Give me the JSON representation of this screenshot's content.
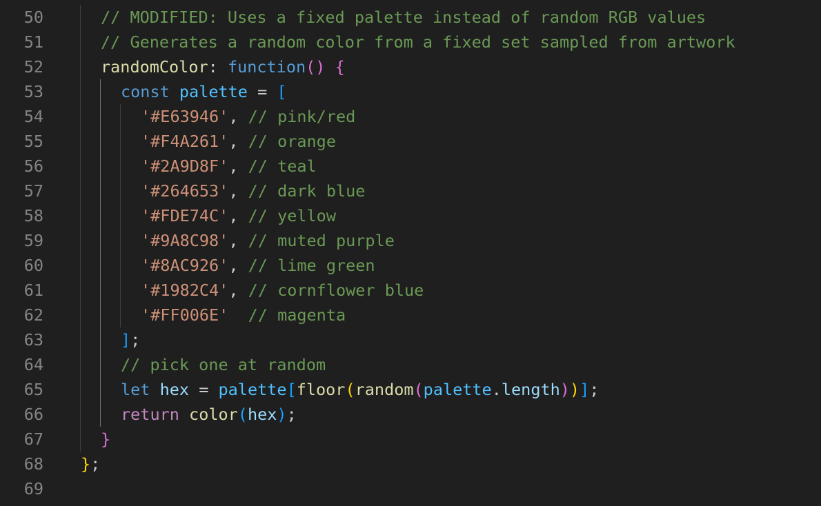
{
  "editor": {
    "language": "javascript",
    "theme_colors": {
      "background": "#1f1f1f",
      "line_number": "#858585",
      "comment": "#6a9955",
      "function": "#dcdcaa",
      "keyword": "#569cd6",
      "control_keyword": "#c586c0",
      "variable": "#9cdcfe",
      "constant": "#4fc1ff",
      "string": "#ce9178",
      "bracket_level_1": "#ffd700",
      "bracket_level_2": "#da70d6",
      "bracket_level_3": "#179fff"
    },
    "lines": [
      {
        "number": "50",
        "indent": 1,
        "tokens": [
          {
            "text": "// MODIFIED: Uses a fixed palette instead of random RGB values",
            "type": "comment"
          }
        ]
      },
      {
        "number": "51",
        "indent": 1,
        "tokens": [
          {
            "text": "// Generates a random color from a fixed set sampled from artwork",
            "type": "comment"
          }
        ]
      },
      {
        "number": "52",
        "indent": 1,
        "tokens": [
          {
            "text": "randomColor",
            "type": "prop"
          },
          {
            "text": ": ",
            "type": "punc"
          },
          {
            "text": "function",
            "type": "kw"
          },
          {
            "text": "()",
            "type": "b2"
          },
          {
            "text": " ",
            "type": "punc"
          },
          {
            "text": "{",
            "type": "b2"
          }
        ]
      },
      {
        "number": "53",
        "indent": 2,
        "tokens": [
          {
            "text": "const",
            "type": "kw"
          },
          {
            "text": " ",
            "type": "punc"
          },
          {
            "text": "palette",
            "type": "const"
          },
          {
            "text": " = ",
            "type": "punc"
          },
          {
            "text": "[",
            "type": "b3"
          }
        ]
      },
      {
        "number": "54",
        "indent": 3,
        "tokens": [
          {
            "text": "'#E63946'",
            "type": "str"
          },
          {
            "text": ", ",
            "type": "punc"
          },
          {
            "text": "// pink/red",
            "type": "comment"
          }
        ]
      },
      {
        "number": "55",
        "indent": 3,
        "tokens": [
          {
            "text": "'#F4A261'",
            "type": "str"
          },
          {
            "text": ", ",
            "type": "punc"
          },
          {
            "text": "// orange",
            "type": "comment"
          }
        ]
      },
      {
        "number": "56",
        "indent": 3,
        "tokens": [
          {
            "text": "'#2A9D8F'",
            "type": "str"
          },
          {
            "text": ", ",
            "type": "punc"
          },
          {
            "text": "// teal",
            "type": "comment"
          }
        ]
      },
      {
        "number": "57",
        "indent": 3,
        "tokens": [
          {
            "text": "'#264653'",
            "type": "str"
          },
          {
            "text": ", ",
            "type": "punc"
          },
          {
            "text": "// dark blue",
            "type": "comment"
          }
        ]
      },
      {
        "number": "58",
        "indent": 3,
        "tokens": [
          {
            "text": "'#FDE74C'",
            "type": "str"
          },
          {
            "text": ", ",
            "type": "punc"
          },
          {
            "text": "// yellow",
            "type": "comment"
          }
        ]
      },
      {
        "number": "59",
        "indent": 3,
        "tokens": [
          {
            "text": "'#9A8C98'",
            "type": "str"
          },
          {
            "text": ", ",
            "type": "punc"
          },
          {
            "text": "// muted purple",
            "type": "comment"
          }
        ]
      },
      {
        "number": "60",
        "indent": 3,
        "tokens": [
          {
            "text": "'#8AC926'",
            "type": "str"
          },
          {
            "text": ", ",
            "type": "punc"
          },
          {
            "text": "// lime green",
            "type": "comment"
          }
        ]
      },
      {
        "number": "61",
        "indent": 3,
        "tokens": [
          {
            "text": "'#1982C4'",
            "type": "str"
          },
          {
            "text": ", ",
            "type": "punc"
          },
          {
            "text": "// cornflower blue",
            "type": "comment"
          }
        ]
      },
      {
        "number": "62",
        "indent": 3,
        "tokens": [
          {
            "text": "'#FF006E'",
            "type": "str"
          },
          {
            "text": "  ",
            "type": "punc"
          },
          {
            "text": "// magenta",
            "type": "comment"
          }
        ]
      },
      {
        "number": "63",
        "indent": 2,
        "tokens": [
          {
            "text": "]",
            "type": "b3"
          },
          {
            "text": ";",
            "type": "punc"
          }
        ]
      },
      {
        "number": "64",
        "indent": 2,
        "tokens": [
          {
            "text": "// pick one at random",
            "type": "comment"
          }
        ]
      },
      {
        "number": "65",
        "indent": 2,
        "tokens": [
          {
            "text": "let",
            "type": "kw"
          },
          {
            "text": " ",
            "type": "punc"
          },
          {
            "text": "hex",
            "type": "var"
          },
          {
            "text": " = ",
            "type": "punc"
          },
          {
            "text": "palette",
            "type": "const"
          },
          {
            "text": "[",
            "type": "b3"
          },
          {
            "text": "floor",
            "type": "func"
          },
          {
            "text": "(",
            "type": "b1"
          },
          {
            "text": "random",
            "type": "func"
          },
          {
            "text": "(",
            "type": "b2"
          },
          {
            "text": "palette",
            "type": "const"
          },
          {
            "text": ".",
            "type": "punc"
          },
          {
            "text": "length",
            "type": "var"
          },
          {
            "text": ")",
            "type": "b2"
          },
          {
            "text": ")",
            "type": "b1"
          },
          {
            "text": "]",
            "type": "b3"
          },
          {
            "text": ";",
            "type": "punc"
          }
        ]
      },
      {
        "number": "66",
        "indent": 2,
        "tokens": [
          {
            "text": "return",
            "type": "ctl"
          },
          {
            "text": " ",
            "type": "punc"
          },
          {
            "text": "color",
            "type": "func"
          },
          {
            "text": "(",
            "type": "b3"
          },
          {
            "text": "hex",
            "type": "var"
          },
          {
            "text": ")",
            "type": "b3"
          },
          {
            "text": ";",
            "type": "punc"
          }
        ]
      },
      {
        "number": "67",
        "indent": 1,
        "tokens": [
          {
            "text": "}",
            "type": "b2"
          }
        ]
      },
      {
        "number": "68",
        "indent": 0,
        "tokens": [
          {
            "text": "}",
            "type": "b1"
          },
          {
            "text": ";",
            "type": "punc"
          }
        ]
      },
      {
        "number": "69",
        "indent": 0,
        "tokens": []
      }
    ]
  }
}
